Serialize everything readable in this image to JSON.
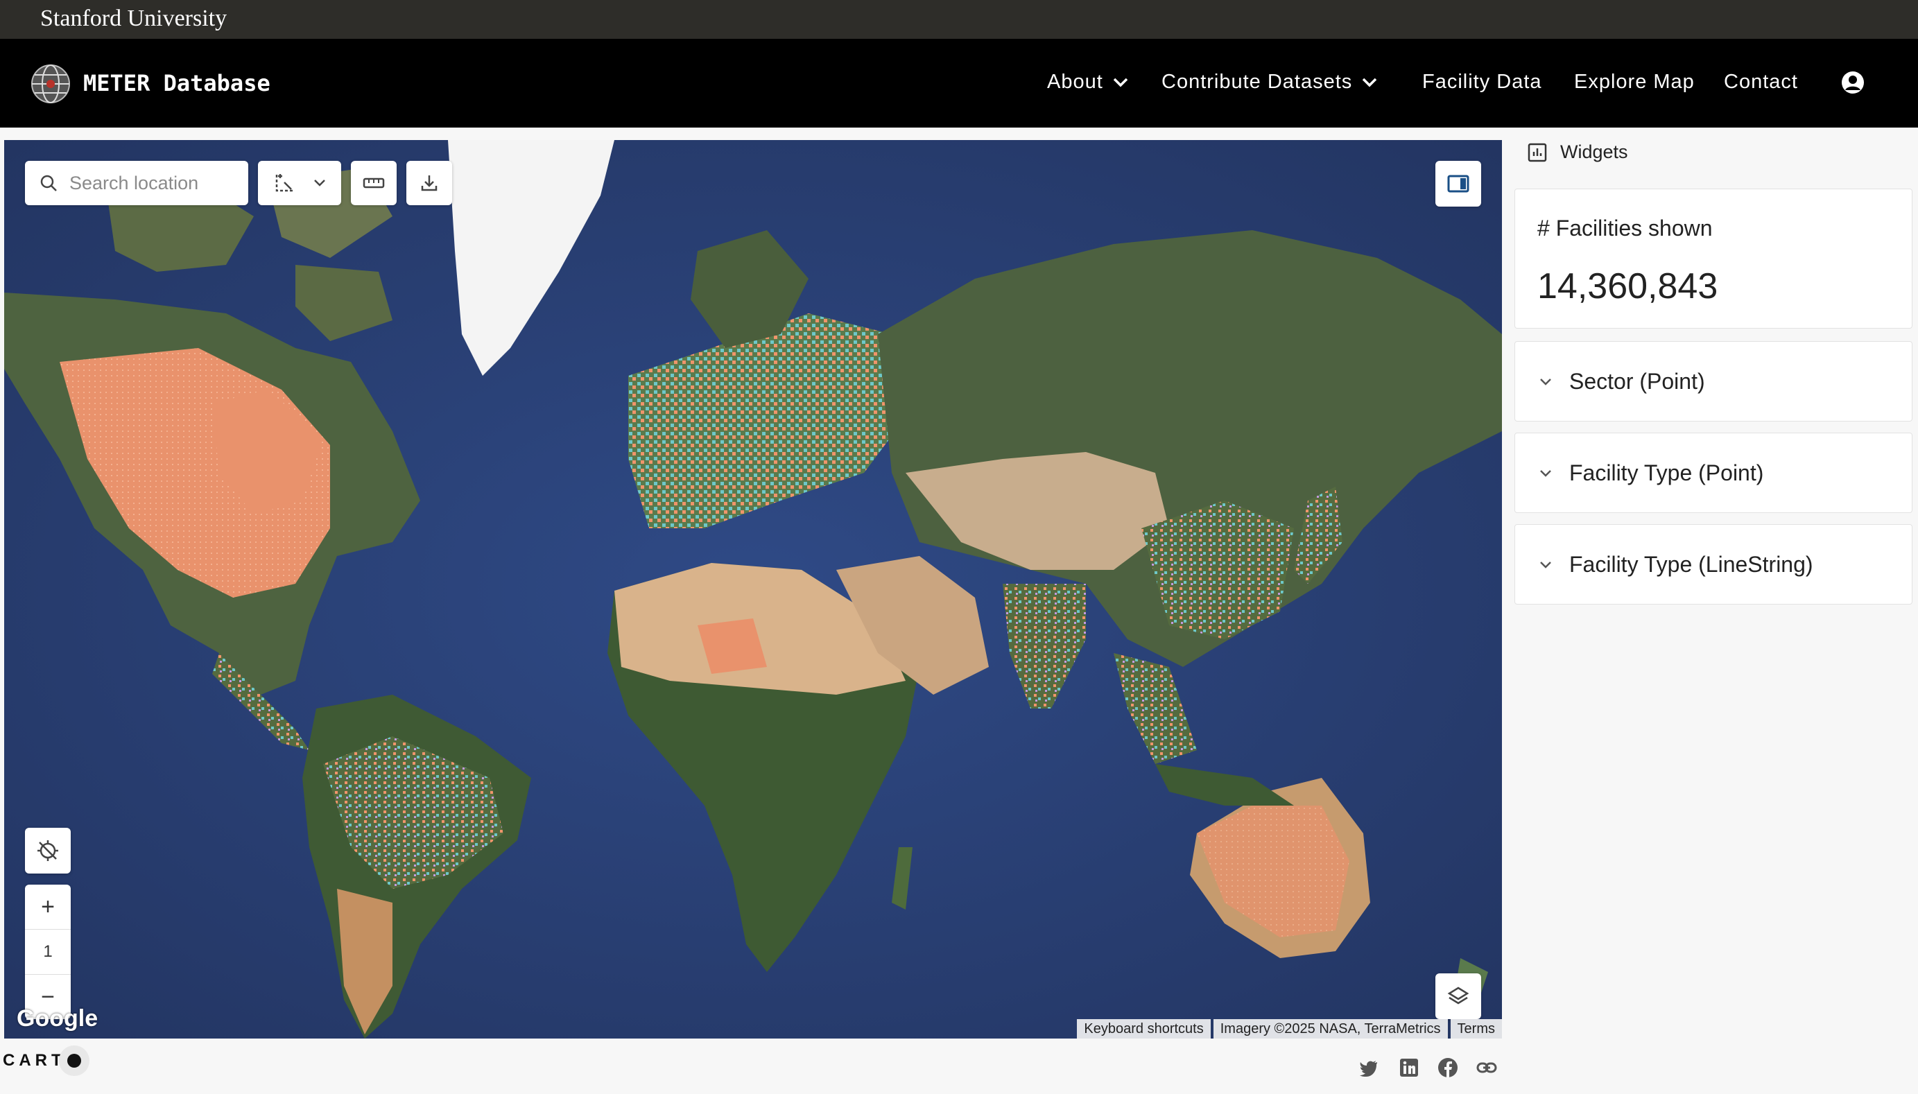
{
  "university": "Stanford University",
  "app": {
    "title": "METER Database",
    "logo_icon": "globe-icon"
  },
  "nav": {
    "about": "About",
    "contribute": "Contribute Datasets",
    "facility_data": "Facility Data",
    "explore_map": "Explore Map",
    "contact": "Contact",
    "user_icon": "user-circle-icon"
  },
  "map": {
    "search_placeholder": "Search location",
    "zoom_level": "1",
    "zoom_in": "+",
    "zoom_out": "−",
    "google_label": "Google",
    "attribution": {
      "shortcuts": "Keyboard shortcuts",
      "imagery": "Imagery ©2025 NASA, TerraMetrics",
      "terms": "Terms"
    },
    "legend_colors": {
      "orange": "#f0956b",
      "teal": "#6ec8c9",
      "purple": "#c49be0",
      "yellow": "#f2c45a"
    }
  },
  "sidebar": {
    "header": "Widgets",
    "facilities_title": "# Facilities shown",
    "facilities_value": "14,360,843",
    "sections": [
      "Sector (Point)",
      "Facility Type (Point)",
      "Facility Type (LineString)"
    ]
  },
  "footer": {
    "carto": "CART",
    "social": [
      "twitter-icon",
      "linkedin-icon",
      "facebook-icon",
      "link-icon"
    ]
  }
}
